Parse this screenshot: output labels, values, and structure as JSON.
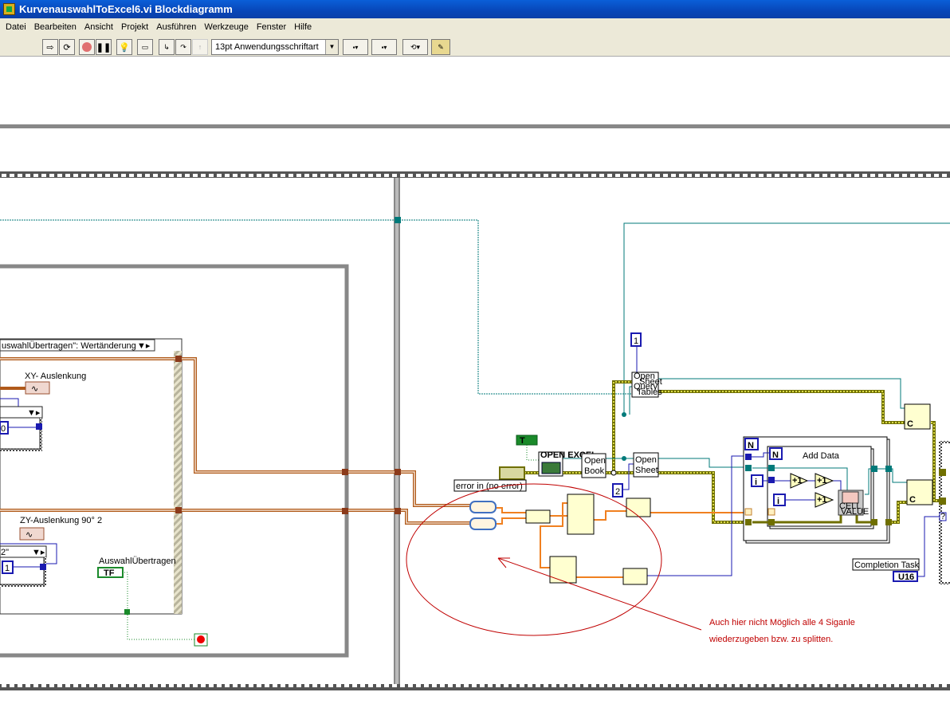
{
  "window": {
    "title": "KurvenauswahlToExcel6.vi Blockdiagramm"
  },
  "menu": [
    "Datei",
    "Bearbeiten",
    "Ansicht",
    "Projekt",
    "Ausführen",
    "Werkzeuge",
    "Fenster",
    "Hilfe"
  ],
  "toolbar": {
    "font": "13pt Anwendungsschriftart",
    "buttons": [
      "run-arrow-icon",
      "run-continuously-icon",
      "abort-icon",
      "pause-icon",
      "highlight-execution-icon",
      "retain-wire-values-icon",
      "step-into-icon",
      "step-over-icon",
      "step-out-icon",
      "align-icon",
      "distribute-icon",
      "reorder-icon",
      "clean-up-icon"
    ]
  },
  "diagram": {
    "event_case": "uswahlÜbertragen\": Wertänderung",
    "labels": {
      "xy": "XY- Auslenkung",
      "zy": "ZY-Auslenkung 90° 2",
      "auswahl": "AuswahlÜbertragen",
      "sel2": "2\"",
      "const0": "0",
      "const1": "1"
    },
    "error_in": "error in (no error)",
    "open_excel": "OPEN EXCEL",
    "open_book": [
      "Open",
      "Book"
    ],
    "open_sheet": [
      "Open",
      "Sheet"
    ],
    "open_query": [
      "Open",
      "Sheet",
      "Query",
      "Tables"
    ],
    "const_top": "1",
    "const_sheet": "2",
    "add_data": "Add Data",
    "loop_n": "N",
    "loop_i": "i",
    "increment": "+1",
    "cell_value": [
      "CELL",
      "VALUE"
    ],
    "completion_task": "Completion Task",
    "u16": "U16",
    "bool_const": "T",
    "tf": "TF",
    "close_c": "C",
    "note": [
      "Auch hier nicht Möglich alle 4 Siganle",
      "wiederzugeben bzw. zu splitten."
    ]
  },
  "colors": {
    "wire_error": "#8a8a00",
    "wire_ref": "#007a7a",
    "wire_waveform": "#b05a1a",
    "wire_int": "#1a1ab0",
    "wire_array": "#f08020",
    "annotation": "#c00000"
  }
}
